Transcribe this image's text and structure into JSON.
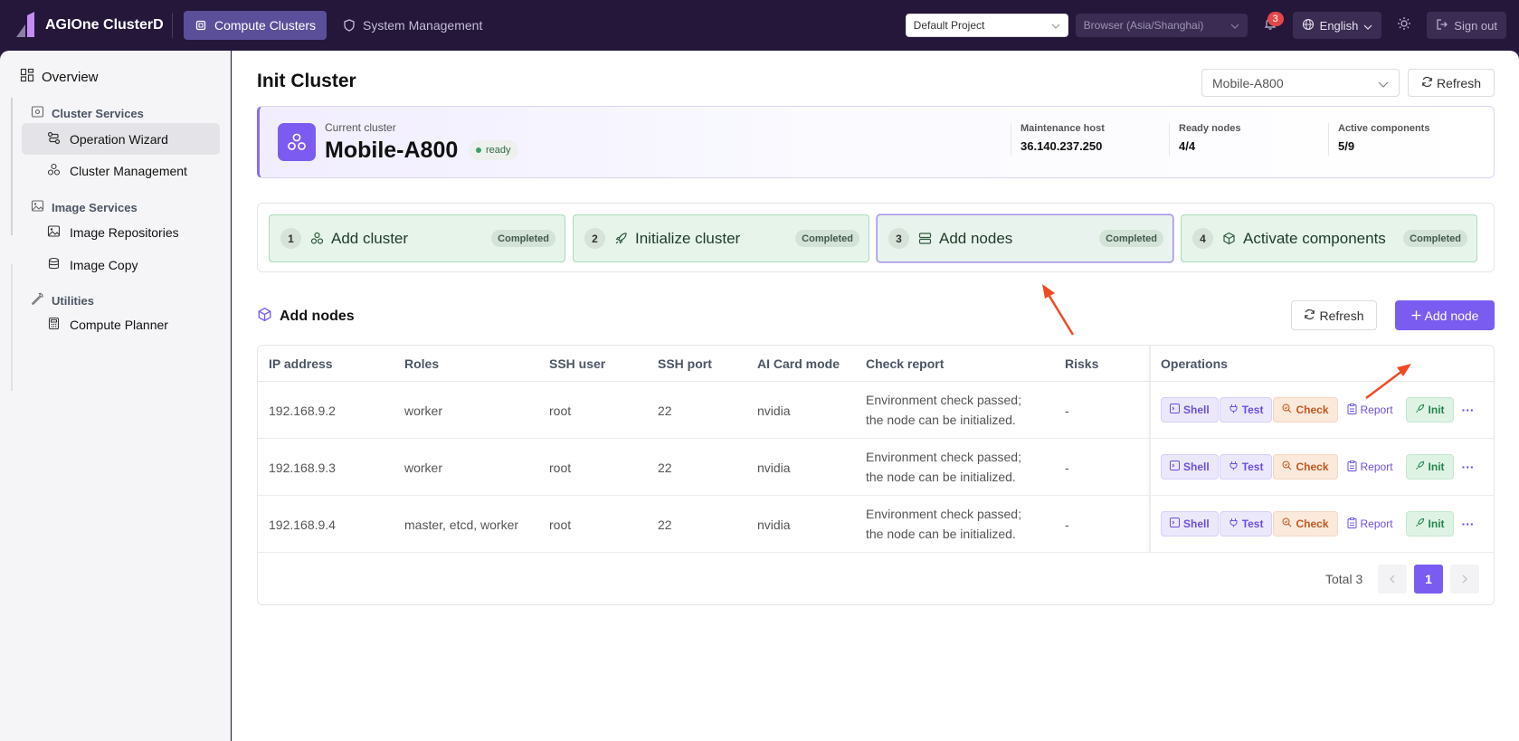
{
  "app": {
    "title": "AGIOne ClusterD"
  },
  "topnav": {
    "tabs": [
      {
        "label": "Compute Clusters",
        "active": true
      },
      {
        "label": "System Management",
        "active": false
      }
    ],
    "project_select": "Default Project",
    "timezone_select": "Browser (Asia/Shanghai)",
    "notification_count": "3",
    "language": "English",
    "sign_out": "Sign out"
  },
  "sidebar": {
    "overview": "Overview",
    "groups": [
      {
        "label": "Cluster Services",
        "items": [
          "Operation Wizard",
          "Cluster Management"
        ]
      },
      {
        "label": "Image Services",
        "items": [
          "Image Repositories",
          "Image Copy"
        ]
      },
      {
        "label": "Utilities",
        "items": [
          "Compute Planner"
        ]
      }
    ],
    "active_item": "Operation Wizard"
  },
  "page": {
    "title": "Init Cluster",
    "cluster_select": "Mobile-A800",
    "refresh_label": "Refresh"
  },
  "cluster": {
    "label": "Current cluster",
    "name": "Mobile-A800",
    "status": "ready",
    "stats": [
      {
        "key": "Maintenance host",
        "value": "36.140.237.250"
      },
      {
        "key": "Ready nodes",
        "value": "4/4"
      },
      {
        "key": "Active components",
        "value": "5/9"
      }
    ]
  },
  "steps": [
    {
      "num": "1",
      "label": "Add cluster",
      "status": "Completed",
      "icon": "cluster-icon"
    },
    {
      "num": "2",
      "label": "Initialize cluster",
      "status": "Completed",
      "icon": "rocket-icon"
    },
    {
      "num": "3",
      "label": "Add nodes",
      "status": "Completed",
      "icon": "server-icon",
      "current": true
    },
    {
      "num": "4",
      "label": "Activate components",
      "status": "Completed",
      "icon": "package-icon"
    }
  ],
  "nodes_section": {
    "title": "Add nodes",
    "refresh_label": "Refresh",
    "add_label": "Add node",
    "columns": [
      "IP address",
      "Roles",
      "SSH user",
      "SSH port",
      "AI Card mode",
      "Check report",
      "Risks",
      "Operations"
    ],
    "rows": [
      {
        "ip": "192.168.9.2",
        "roles": "worker",
        "user": "root",
        "port": "22",
        "mode": "nvidia",
        "report1": "Environment check passed;",
        "report2": "the node can be initialized.",
        "risks": "-"
      },
      {
        "ip": "192.168.9.3",
        "roles": "worker",
        "user": "root",
        "port": "22",
        "mode": "nvidia",
        "report1": "Environment check passed;",
        "report2": "the node can be initialized.",
        "risks": "-"
      },
      {
        "ip": "192.168.9.4",
        "roles": "master, etcd, worker",
        "user": "root",
        "port": "22",
        "mode": "nvidia",
        "report1": "Environment check passed;",
        "report2": "the node can be initialized.",
        "risks": "-"
      }
    ],
    "ops": {
      "shell": "Shell",
      "test": "Test",
      "check": "Check",
      "report": "Report",
      "init": "Init",
      "more": "···"
    },
    "pagination": {
      "total": "Total 3",
      "current": "1"
    }
  },
  "colors": {
    "accent": "#7a5cf0",
    "topbar": "#24173a",
    "success_bg": "#e6f4ea",
    "annotation": "#f04a24"
  }
}
